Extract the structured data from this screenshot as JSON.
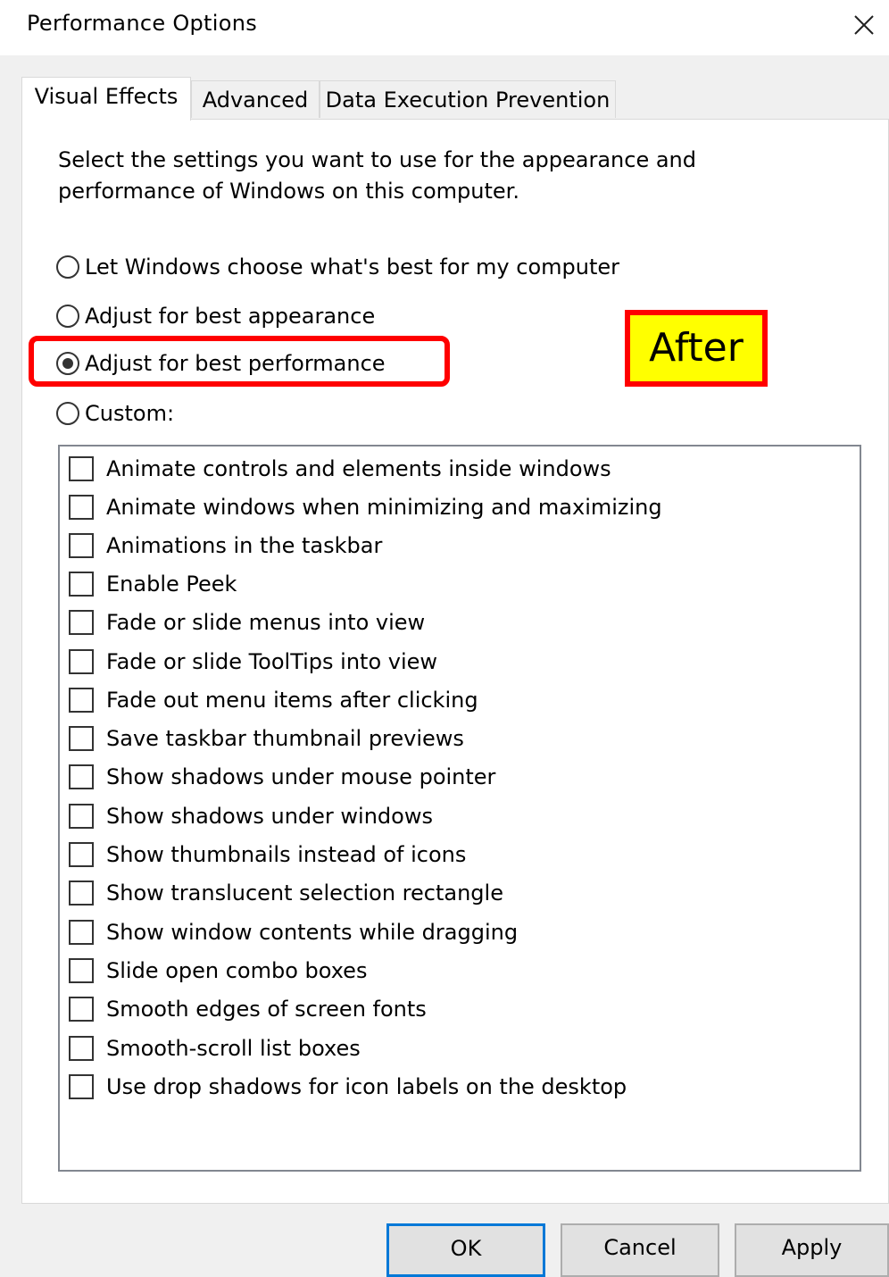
{
  "window": {
    "title": "Performance Options"
  },
  "tabs": [
    {
      "label": "Visual Effects",
      "active": true
    },
    {
      "label": "Advanced",
      "active": false
    },
    {
      "label": "Data Execution Prevention",
      "active": false
    }
  ],
  "visual_effects": {
    "description": "Select the settings you want to use for the appearance and performance of Windows on this computer.",
    "radio_options": [
      {
        "label": "Let Windows choose what's best for my computer",
        "selected": false
      },
      {
        "label": "Adjust for best appearance",
        "selected": false
      },
      {
        "label": "Adjust for best performance",
        "selected": true
      },
      {
        "label": "Custom:",
        "selected": false
      }
    ],
    "effects": [
      {
        "label": "Animate controls and elements inside windows",
        "checked": false
      },
      {
        "label": "Animate windows when minimizing and maximizing",
        "checked": false
      },
      {
        "label": "Animations in the taskbar",
        "checked": false
      },
      {
        "label": "Enable Peek",
        "checked": false
      },
      {
        "label": "Fade or slide menus into view",
        "checked": false
      },
      {
        "label": "Fade or slide ToolTips into view",
        "checked": false
      },
      {
        "label": "Fade out menu items after clicking",
        "checked": false
      },
      {
        "label": "Save taskbar thumbnail previews",
        "checked": false
      },
      {
        "label": "Show shadows under mouse pointer",
        "checked": false
      },
      {
        "label": "Show shadows under windows",
        "checked": false
      },
      {
        "label": "Show thumbnails instead of icons",
        "checked": false
      },
      {
        "label": "Show translucent selection rectangle",
        "checked": false
      },
      {
        "label": "Show window contents while dragging",
        "checked": false
      },
      {
        "label": "Slide open combo boxes",
        "checked": false
      },
      {
        "label": "Smooth edges of screen fonts",
        "checked": false
      },
      {
        "label": "Smooth-scroll list boxes",
        "checked": false
      },
      {
        "label": "Use drop shadows for icon labels on the desktop",
        "checked": false
      }
    ]
  },
  "annotation": {
    "badge_text": "After",
    "highlight_color": "#ff0000",
    "badge_color": "#ffff00"
  },
  "buttons": {
    "ok": "OK",
    "cancel": "Cancel",
    "apply": "Apply"
  },
  "icons": {
    "close": "close-icon"
  }
}
